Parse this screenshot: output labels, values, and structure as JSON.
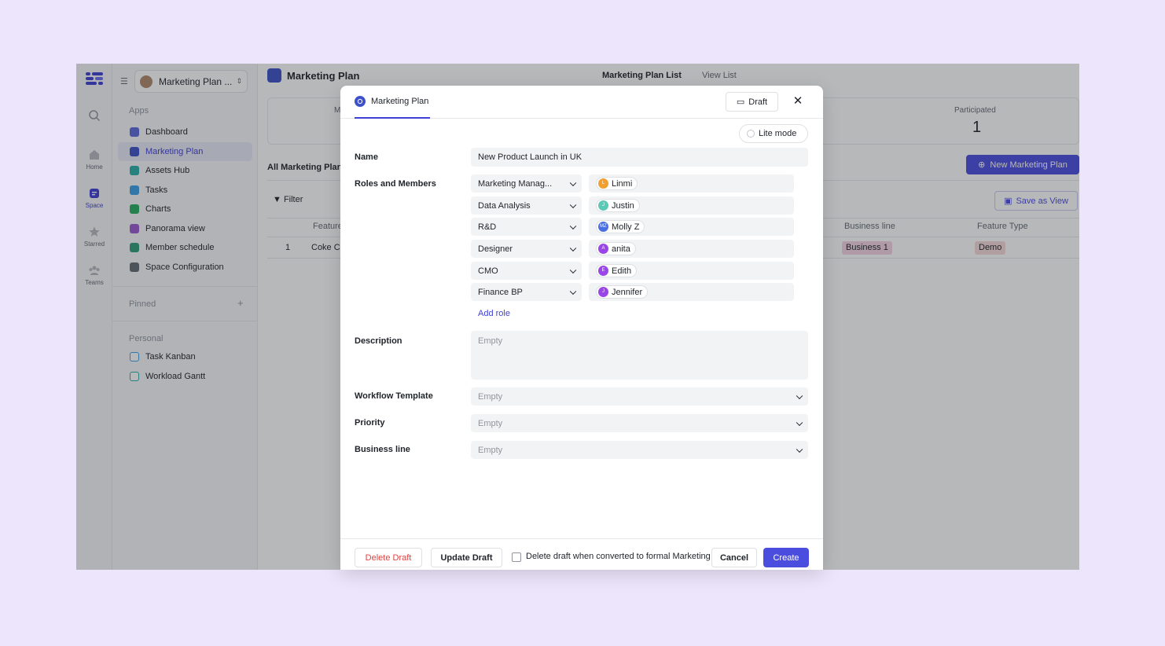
{
  "sidebar": {
    "space_name": "Marketing Plan ...",
    "apps_label": "Apps",
    "apps": [
      {
        "label": "Dashboard",
        "color": "#5b6bd9"
      },
      {
        "label": "Marketing Plan",
        "color": "#3f51c8"
      },
      {
        "label": "Assets Hub",
        "color": "#2bb0a8"
      },
      {
        "label": "Tasks",
        "color": "#3aa0e8"
      },
      {
        "label": "Charts",
        "color": "#27ae60"
      },
      {
        "label": "Panorama view",
        "color": "#9b59d0"
      },
      {
        "label": "Member schedule",
        "color": "#2e9e7a"
      },
      {
        "label": "Space Configuration",
        "color": "#646a73"
      }
    ],
    "pinned_label": "Pinned",
    "personal_label": "Personal",
    "personal": [
      {
        "label": "Task Kanban"
      },
      {
        "label": "Workload Gantt"
      }
    ]
  },
  "rail": {
    "home": "Home",
    "space": "Space",
    "starred": "Starred",
    "teams": "Teams"
  },
  "main": {
    "title": "Marketing Plan",
    "tabs": [
      "Marketing Plan List",
      "View List"
    ],
    "stat_partial": "M",
    "participated_label": "Participated",
    "participated_value": "1",
    "new_button": "New Marketing Plan",
    "all_tab": "All Marketing Plan",
    "filter": "Filter",
    "save_view": "Save as View",
    "col_feature": "Feature",
    "col_business": "Business line",
    "col_type": "Feature Type",
    "row_num": "1",
    "row_name": "Coke C",
    "row_business": "Business 1",
    "row_type": "Demo"
  },
  "modal": {
    "tab_title": "Marketing Plan",
    "draft_label": "Draft",
    "lite_mode": "Lite mode",
    "name_label": "Name",
    "name_value": "New Product Launch in UK",
    "roles_label": "Roles and Members",
    "roles": [
      {
        "role": "Marketing Manag...",
        "member": "Linmi",
        "initials": "L",
        "color": "#f0a030"
      },
      {
        "role": "Data Analysis",
        "member": "Justin",
        "initials": "J",
        "color": "#5cc9b6"
      },
      {
        "role": "R&D",
        "member": "Molly Z",
        "initials": "MZ",
        "color": "#4a6fe0"
      },
      {
        "role": "Designer",
        "member": "anita",
        "initials": "A",
        "color": "#9a45e8"
      },
      {
        "role": "CMO",
        "member": "Edith",
        "initials": "E",
        "color": "#9a45e8"
      },
      {
        "role": "Finance BP",
        "member": "Jennifer",
        "initials": "J",
        "color": "#9a45e8"
      }
    ],
    "add_role": "Add role",
    "description_label": "Description",
    "description_placeholder": "Empty",
    "workflow_label": "Workflow Template",
    "workflow_value": "Empty",
    "priority_label": "Priority",
    "priority_value": "Empty",
    "business_label": "Business line",
    "business_value": "Empty",
    "footer": {
      "delete_draft": "Delete Draft",
      "update_draft": "Update Draft",
      "checkbox_label": "Delete draft when converted to formal Marketing Plan",
      "cancel": "Cancel",
      "create": "Create"
    }
  }
}
